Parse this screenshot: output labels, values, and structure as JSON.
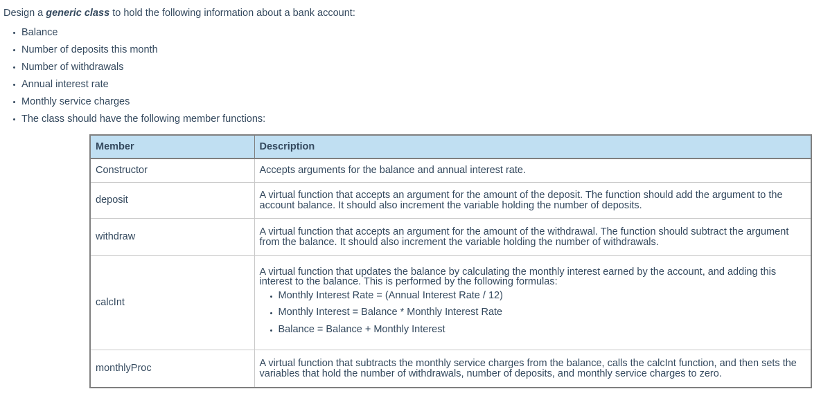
{
  "intro": {
    "before": "Design a ",
    "emphasis": "generic class",
    "after": " to hold the following information about a bank account:"
  },
  "requirements": [
    "Balance",
    "Number of deposits this month",
    "Number of withdrawals",
    "Annual interest rate",
    "Monthly service charges",
    "The class should have the following member functions:"
  ],
  "table": {
    "headers": {
      "member": "Member",
      "description": "Description"
    },
    "header_bg": "#c0dff2",
    "border_color": "#7f7f7f",
    "rows": [
      {
        "member": "Constructor",
        "description": "Accepts arguments for the balance and annual interest rate."
      },
      {
        "member": "deposit",
        "description": "A virtual function that accepts an argument for the amount of the deposit. The function should add the argument to the account balance. It should also increment the variable holding the number of deposits."
      },
      {
        "member": "withdraw",
        "description": "A virtual function that accepts an argument for the amount of the withdrawal. The function should subtract the argument from the balance. It should also increment the variable holding the number of withdrawals."
      },
      {
        "member": "calcInt",
        "description": "A virtual function that updates the balance by calculating the monthly interest earned by the account, and adding this interest to the balance. This is performed by the following formulas:",
        "formulas": [
          "Monthly Interest Rate = (Annual Interest Rate / 12)",
          "Monthly Interest = Balance * Monthly Interest Rate",
          "Balance = Balance + Monthly Interest"
        ]
      },
      {
        "member": "monthlyProc",
        "description": "A virtual function that subtracts the monthly service charges from the balance, calls the calcInt function, and then sets the variables that hold the number of withdrawals, number of deposits, and monthly service charges to zero."
      }
    ]
  }
}
